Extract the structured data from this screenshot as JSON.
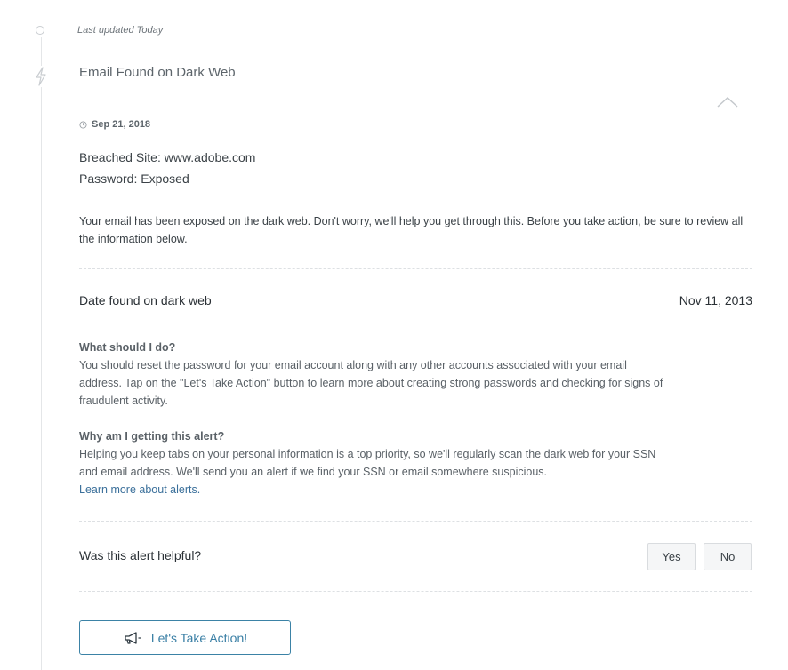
{
  "timeline": {
    "last_updated": "Last updated Today"
  },
  "alert": {
    "title": "Email Found on Dark Web",
    "date": "Sep 21, 2018",
    "breached_site": "Breached Site: www.adobe.com",
    "password_status": "Password: Exposed",
    "description": "Your email has been exposed on the dark web. Don't worry, we'll help you get through this. Before you take action, be sure to review all the information below."
  },
  "found": {
    "label": "Date found on dark web",
    "value": "Nov 11, 2013"
  },
  "faq": [
    {
      "question": "What should I do?",
      "answer": "You should reset the password for your email account along with any other accounts associated with your email address. Tap on the \"Let's Take Action\" button to learn more about creating strong passwords and checking for signs of fraudulent activity.",
      "link": ""
    },
    {
      "question": "Why am I getting this alert?",
      "answer": "Helping you keep tabs on your personal information is a top priority, so we'll regularly scan the dark web for your SSN and email address. We'll send you an alert if we find your SSN or email somewhere suspicious.",
      "link": "Learn more about alerts."
    }
  ],
  "feedback": {
    "question": "Was this alert helpful?",
    "yes": "Yes",
    "no": "No"
  },
  "action": {
    "label": "Let's Take Action!",
    "icon": "megaphone-icon"
  },
  "colors": {
    "accent": "#3a7fa5",
    "text": "#3b4247",
    "muted": "#5d656b",
    "divider": "#dde0e3"
  }
}
